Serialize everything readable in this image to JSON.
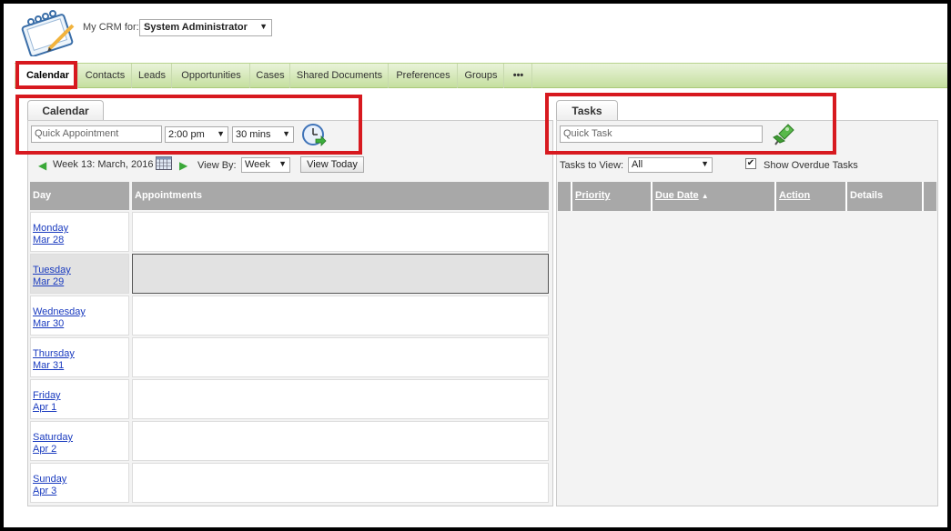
{
  "header": {
    "crm_label": "My CRM for:",
    "user": "System Administrator"
  },
  "nav": {
    "tabs": [
      "Calendar",
      "Contacts",
      "Leads",
      "Opportunities",
      "Cases",
      "Shared Documents",
      "Preferences",
      "Groups",
      "•••"
    ],
    "active": "Calendar"
  },
  "calendar": {
    "tab_label": "Calendar",
    "quick_appointment_placeholder": "Quick Appointment",
    "time": "2:00 pm",
    "duration": "30 mins",
    "week_label": "Week 13: March, 2016",
    "view_by_label": "View By:",
    "view_by_value": "Week",
    "view_today": "View Today",
    "col_day": "Day",
    "col_appointments": "Appointments",
    "days": [
      {
        "day": "Monday",
        "date": "Mar 28"
      },
      {
        "day": "Tuesday",
        "date": "Mar 29"
      },
      {
        "day": "Wednesday",
        "date": "Mar 30"
      },
      {
        "day": "Thursday",
        "date": "Mar 31"
      },
      {
        "day": "Friday",
        "date": "Apr 1"
      },
      {
        "day": "Saturday",
        "date": "Apr 2"
      },
      {
        "day": "Sunday",
        "date": "Apr 3"
      }
    ],
    "selected_day": "Tuesday"
  },
  "tasks": {
    "tab_label": "Tasks",
    "quick_task_placeholder": "Quick Task",
    "view_label": "Tasks to View:",
    "view_value": "All",
    "overdue_label": "Show Overdue Tasks",
    "overdue_checked": true,
    "columns": {
      "priority": "Priority",
      "due_date": "Due Date",
      "action": "Action",
      "details": "Details"
    }
  },
  "colors": {
    "highlight": "#d7191f",
    "nav_green": "#c5df9f",
    "header_gray": "#a8a8a8",
    "link": "#1a3bbf"
  }
}
